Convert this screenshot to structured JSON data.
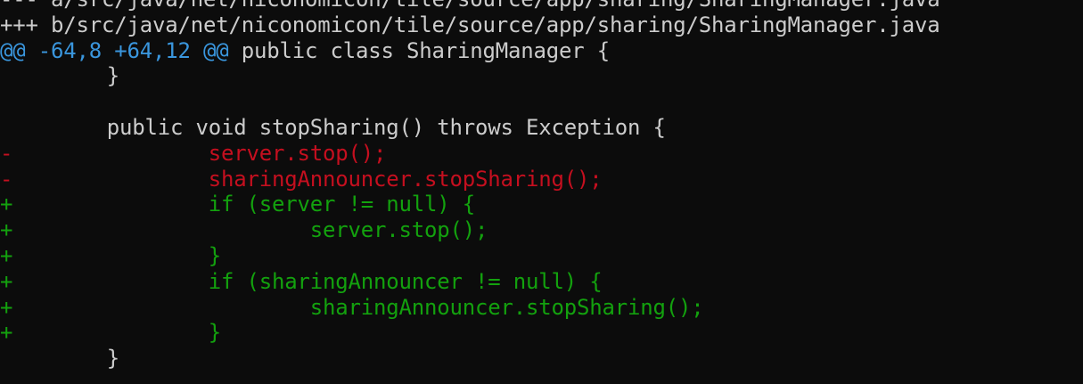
{
  "colors": {
    "background": "#0c0c0c",
    "text": "#cccccc",
    "hunk_header": "#3a96dd",
    "removed": "#c50f1f",
    "added": "#13a10e"
  },
  "diff": {
    "old_file": "--- a/src/java/net/niconomicon/tile/source/app/sharing/SharingManager.java",
    "new_file": "+++ b/src/java/net/niconomicon/tile/source/app/sharing/SharingManager.java",
    "hunk": {
      "range": "@@ -64,8 +64,12 @@",
      "context": " public class SharingManager {"
    },
    "lines": [
      {
        "type": "context",
        "marker": " ",
        "text": "       }"
      },
      {
        "type": "context",
        "marker": " ",
        "text": ""
      },
      {
        "type": "context",
        "marker": " ",
        "text": "       public void stopSharing() throws Exception {"
      },
      {
        "type": "removed",
        "marker": "-",
        "text": "               server.stop();"
      },
      {
        "type": "removed",
        "marker": "-",
        "text": "               sharingAnnouncer.stopSharing();"
      },
      {
        "type": "added",
        "marker": "+",
        "text": "               if (server != null) {"
      },
      {
        "type": "added",
        "marker": "+",
        "text": "                       server.stop();"
      },
      {
        "type": "added",
        "marker": "+",
        "text": "               }"
      },
      {
        "type": "added",
        "marker": "+",
        "text": "               if (sharingAnnouncer != null) {"
      },
      {
        "type": "added",
        "marker": "+",
        "text": "                       sharingAnnouncer.stopSharing();"
      },
      {
        "type": "added",
        "marker": "+",
        "text": "               }"
      },
      {
        "type": "context",
        "marker": " ",
        "text": "       }"
      }
    ]
  }
}
